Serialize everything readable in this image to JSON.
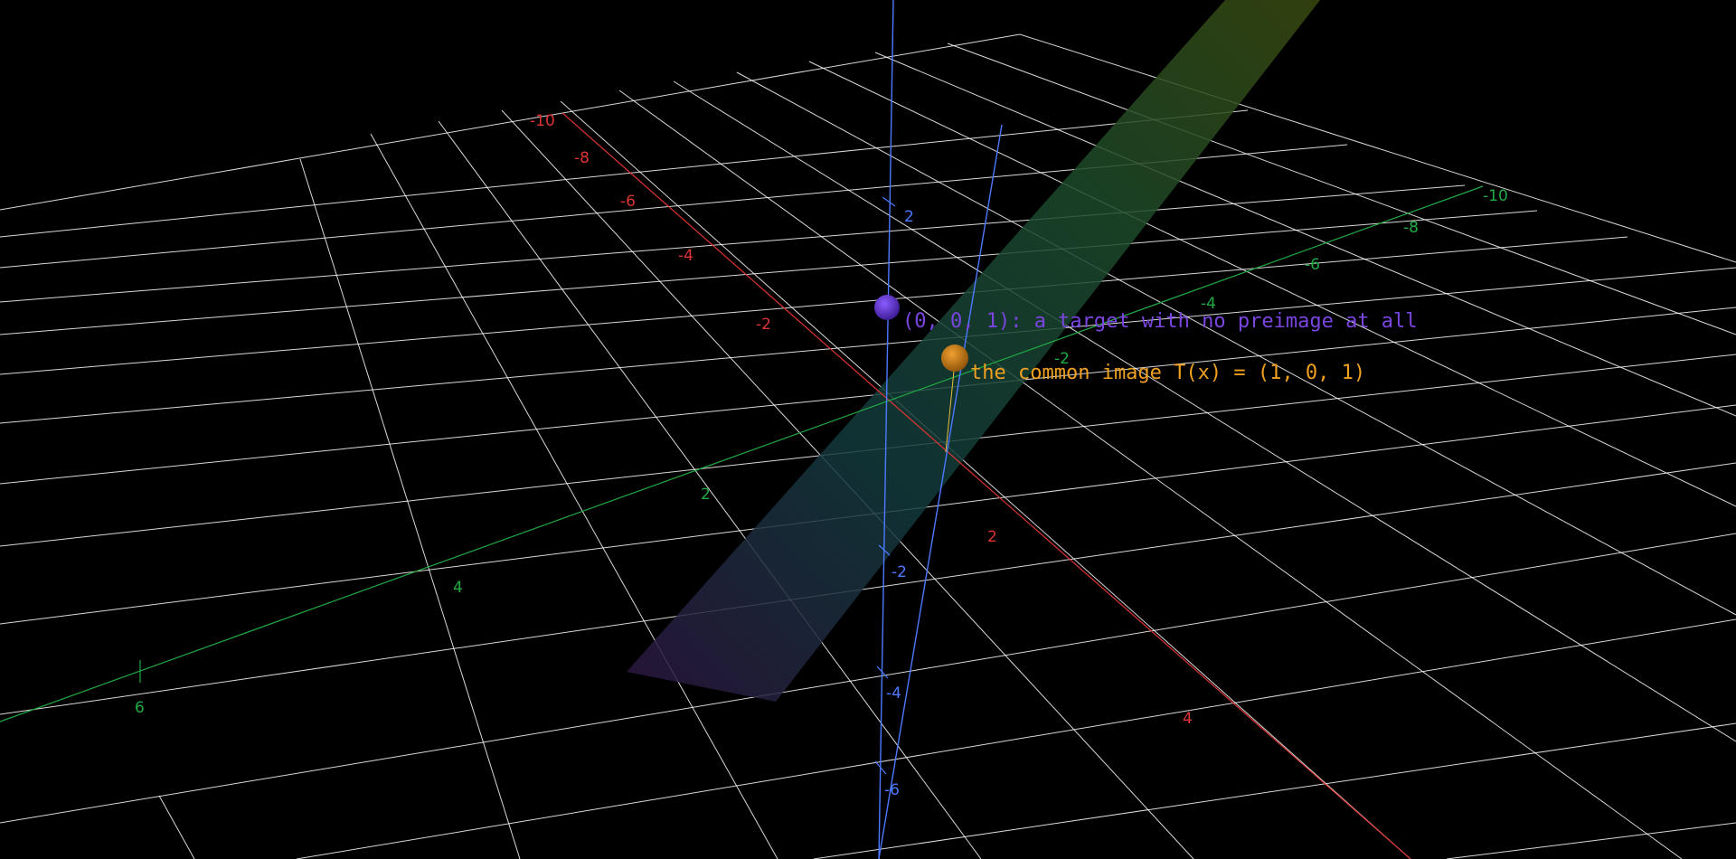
{
  "scene": {
    "background": "#000000",
    "grid_color": "#ffffff",
    "axes": {
      "x": {
        "color": "#dd3333",
        "tick_labels": [
          "-10",
          "-8",
          "-6",
          "-4",
          "-2",
          "2",
          "4"
        ]
      },
      "y": {
        "color": "#22aa44",
        "tick_labels": [
          "-10",
          "-8",
          "-6",
          "-4",
          "-2",
          "2",
          "4",
          "6"
        ]
      },
      "z": {
        "color": "#4d79ff",
        "tick_labels": [
          "2",
          "-2",
          "-4",
          "-6"
        ]
      }
    },
    "plane": {
      "description_color": "#1f5a3a",
      "edge_colors": [
        "#2e1b4a",
        "#2c4a1e"
      ]
    },
    "points": [
      {
        "coords": "(0, 0, 1)",
        "color": "#5b2bbf",
        "label": "(0, 0, 1): a target with no preimage at all",
        "label_color": "#7b45e0"
      },
      {
        "coords": "(1, 0, 1)",
        "color": "#c8780e",
        "label": "the common image T(x) = (1, 0, 1)",
        "label_color": "#f0a020"
      }
    ],
    "image_line": {
      "color": "#4d79ff"
    }
  }
}
